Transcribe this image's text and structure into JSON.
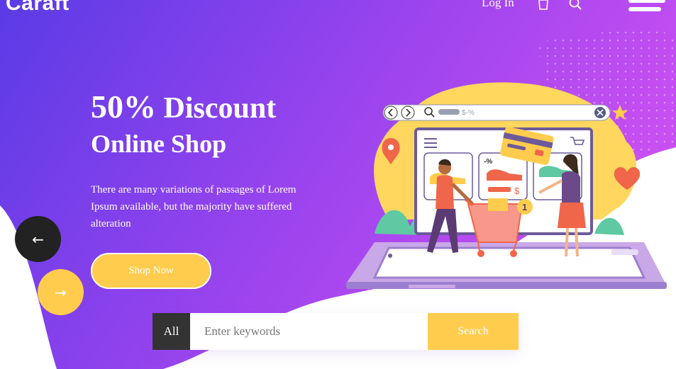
{
  "header": {
    "logo": "Caraft",
    "login_label": "Log In",
    "icons": [
      "shopping-bag-icon",
      "search-icon",
      "hamburger-menu-icon"
    ]
  },
  "hero": {
    "title_big": "50%",
    "title_rest": "Discount",
    "title_line2": "Online Shop",
    "description": "There are many variations of passages of Lorem Ipsum available, but the majority have suffered alteration",
    "cta_label": "Shop Now"
  },
  "slider": {
    "prev_label": "←",
    "next_label": "→"
  },
  "search": {
    "category_label": "All",
    "placeholder": "Enter keywords",
    "value": "",
    "button_label": "Search"
  },
  "illustration": {
    "browser_search_text": "$-%",
    "discount_tag": "-%",
    "price_tag": "$",
    "cart_badge": "1"
  },
  "colors": {
    "gradient_start": "#5a3be6",
    "gradient_end": "#c44df0",
    "accent_yellow": "#ffcc4d",
    "dark": "#222222"
  }
}
